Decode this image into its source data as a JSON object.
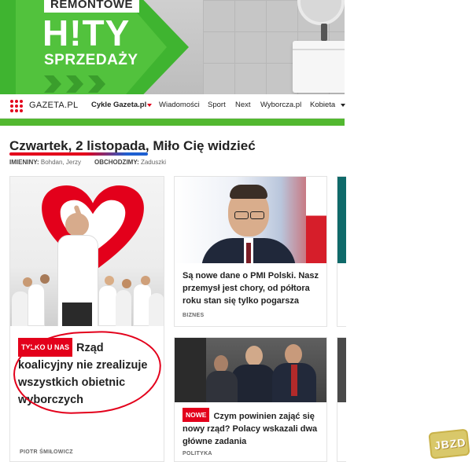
{
  "banner": {
    "label": "REMONTOWE",
    "headline": "H!TY",
    "subline": "SPRZEDAŻY",
    "accent_color": "#52c23d"
  },
  "navbar": {
    "logo_text": "GAZETA.PL",
    "items": [
      {
        "label": "Cykle Gazeta.pl"
      },
      {
        "label": "Wiadomości"
      },
      {
        "label": "Sport"
      },
      {
        "label": "Next"
      },
      {
        "label": "Wyborcza.pl"
      },
      {
        "label": "Kobieta"
      }
    ],
    "brand_color": "#e3001b",
    "strip_color": "#52b830"
  },
  "greeting": {
    "text": "Czwartek, 2 listopada, Miło Cię widzieć",
    "imieniny_label": "IMIENINY:",
    "imieniny_value": "Bohdan, Jerzy",
    "obchodzimy_label": "OBCHODZIMY:",
    "obchodzimy_value": "Zaduszki"
  },
  "articles": {
    "main": {
      "badge": "TYLKO U NAS",
      "title": "Rząd koalicyjny nie zrealizuje wszystkich obietnic wyborczych",
      "author": "PIOTR ŚMIŁOWICZ"
    },
    "second": {
      "title": "Są nowe dane o PMI Polski. Nasz przemysł jest chory, od półtora roku stan się tylko pogarsza",
      "category": "BIZNES"
    },
    "third": {
      "badge": "NOWE",
      "title": "Czym powinien zająć się nowy rząd? Polacy wskazali dwa główne zadania",
      "category": "POLITYKA"
    }
  },
  "watermark": "JBZD"
}
